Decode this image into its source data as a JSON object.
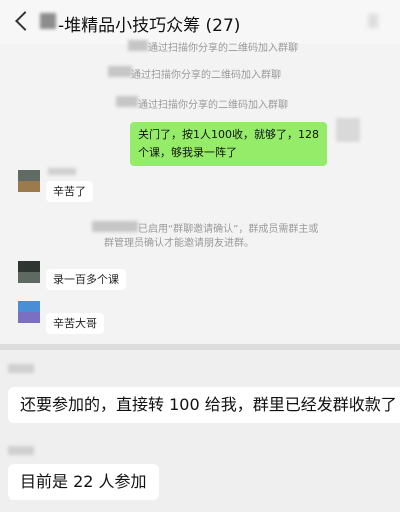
{
  "header": {
    "title": "-堆精品小技巧众筹 (27)"
  },
  "system_messages": {
    "join1": "通过扫描你分享的二维码加入群聊",
    "join2": "通过扫描你分享的二维码加入群聊",
    "join3": "通过扫描你分享的二维码加入群聊",
    "invite_line1": "已启用“群聊邀请确认”，群成员需群主或",
    "invite_line2": "群管理员确认才能邀请朋友进群。"
  },
  "messages": {
    "outgoing": "关门了，按1人100收，就够了，128个课，够我录一阵了",
    "reply1": "辛苦了",
    "reply2": "录一百多个课",
    "reply3": "辛苦大哥",
    "screen2_msg1": "还要参加的，直接转 100 给我，群里已经发群收款了",
    "screen2_msg2": "目前是 22 人参加"
  },
  "colors": {
    "outgoing_bubble": "#95ec69",
    "incoming_bubble": "#ffffff",
    "chat_background": "#f3f3f3"
  }
}
